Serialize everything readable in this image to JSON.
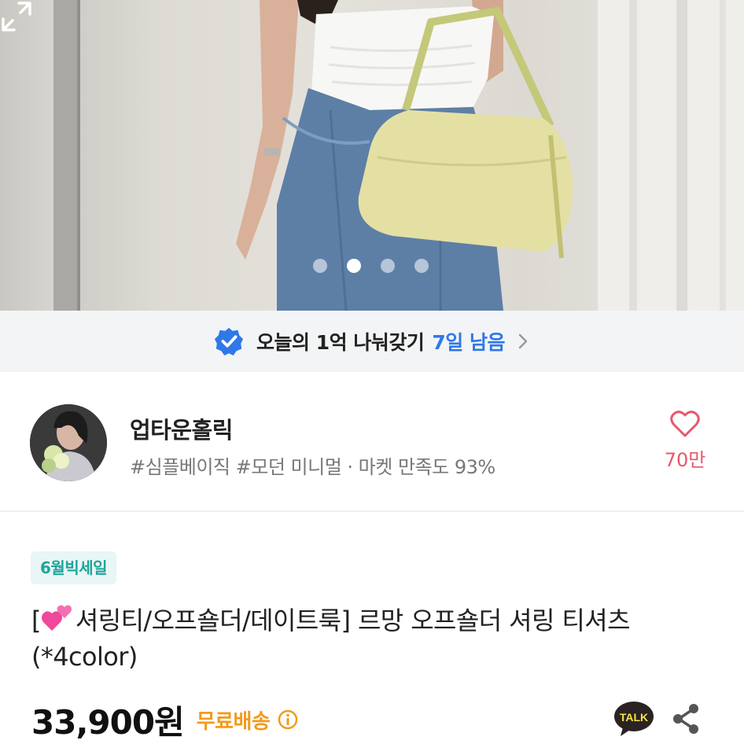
{
  "carousel": {
    "image_alt": "model wearing a white shirring off-shoulder t-shirt with blue jeans and a lime shoulder bag",
    "slide_count": 4,
    "active_slide": 2
  },
  "promo": {
    "text": "오늘의 1억 나눠갖기",
    "remaining": "7일 남음",
    "accent_color": "#2f78e8"
  },
  "shop": {
    "name": "업타운홀릭",
    "meta": "#심플베이직 #모던 미니멀 · 마켓 만족도 93%",
    "likes": "70만",
    "like_color": "#e8576b"
  },
  "product": {
    "badge": "6월빅세일",
    "title_prefix": "[",
    "title_rest": "셔링티/오프숄더/데이트룩] 르망 오프숄더 셔링 티셔츠 (*4color)",
    "price": "33,900원",
    "shipping": "무료배송",
    "ship_color": "#f39a1d"
  },
  "actions": {
    "talk_label": "TALK"
  }
}
